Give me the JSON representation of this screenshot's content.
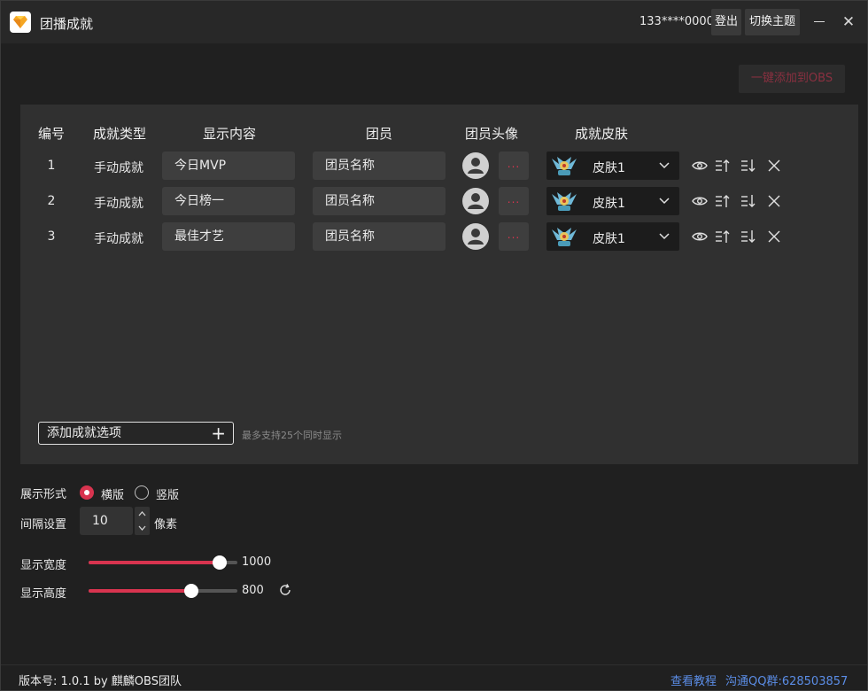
{
  "app": {
    "title": "团播成就",
    "user_phone": "133****0000",
    "logout_label": "登出",
    "theme_label": "切换主题",
    "accent_color": "#d8344f"
  },
  "toolbar": {
    "add_obs_label": "一键添加到OBS"
  },
  "table": {
    "headers": {
      "num": "编号",
      "type": "成就类型",
      "content": "显示内容",
      "member": "团员",
      "avatar": "团员头像",
      "skin": "成就皮肤"
    },
    "rows": [
      {
        "num": "1",
        "type": "手动成就",
        "content": "今日MVP",
        "member": "团员名称",
        "more": "...",
        "skin": "皮肤1"
      },
      {
        "num": "2",
        "type": "手动成就",
        "content": "今日榜一",
        "member": "团员名称",
        "more": "...",
        "skin": "皮肤1"
      },
      {
        "num": "3",
        "type": "手动成就",
        "content": "最佳才艺",
        "member": "团员名称",
        "more": "...",
        "skin": "皮肤1"
      }
    ],
    "add_label": "添加成就选项",
    "add_hint": "最多支持25个同时显示"
  },
  "settings": {
    "display_mode_label": "展示形式",
    "mode_horizontal": "横版",
    "mode_vertical": "竖版",
    "selected_mode": "horizontal",
    "spacing_label": "间隔设置",
    "spacing_value": "10",
    "spacing_unit": "像素",
    "width_label": "显示宽度",
    "width_value": "1000",
    "width_fraction": 0.88,
    "height_label": "显示高度",
    "height_value": "800",
    "height_fraction": 0.69
  },
  "footer": {
    "version": "版本号: 1.0.1 by 麒麟OBS团队",
    "tutorial": "查看教程",
    "qq_group": "沟通QQ群:628503857"
  }
}
